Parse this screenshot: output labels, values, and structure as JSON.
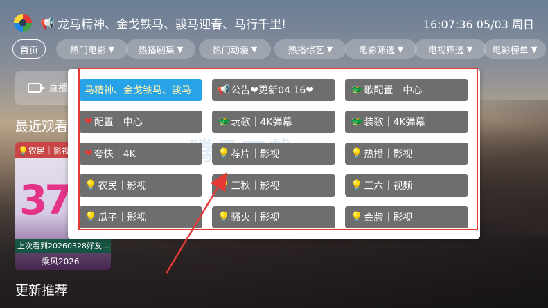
{
  "header": {
    "announcement": "龙马精神、金戈铁马、骏马迎春、马行千里!",
    "clock": "16:07:36 05/03 周日"
  },
  "nav": {
    "items": [
      {
        "label": "首页",
        "filter": false,
        "active": true
      },
      {
        "label": "热门电影",
        "filter": true
      },
      {
        "label": "热播剧集",
        "filter": true
      },
      {
        "label": "热门动漫",
        "filter": true
      },
      {
        "label": "热播综艺",
        "filter": true
      },
      {
        "label": "电影筛选",
        "filter": true
      },
      {
        "label": "电视筛选",
        "filter": true
      },
      {
        "label": "电影榜单",
        "filter": true
      }
    ]
  },
  "left": {
    "live_label": "直播",
    "recent_title": "最近观看",
    "recent_card": {
      "tag": "💡农民｜影视",
      "art": "37",
      "art2": "乘",
      "art3": "2026",
      "progress": "上次看到20260328好友...",
      "name": "乘风2026"
    },
    "update_title": "更新推荐"
  },
  "popup": {
    "watermark": "腾品下载",
    "sources": [
      {
        "icon": "",
        "icon_name": "none",
        "label": "马精神、金戈铁马、骏马",
        "selected": true
      },
      {
        "icon": "📢",
        "icon_name": "horn-icon",
        "label": "公告❤更新04.16❤"
      },
      {
        "icon": "🐲",
        "icon_name": "dragon-icon",
        "label": "歌配置｜中心"
      },
      {
        "icon": "❤",
        "icon_name": "heart-icon",
        "label": "配置｜中心"
      },
      {
        "icon": "🐲",
        "icon_name": "dragon-icon",
        "label": "玩歌｜4K弹幕"
      },
      {
        "icon": "🐲",
        "icon_name": "dragon-icon",
        "label": "装歌｜4K弹幕"
      },
      {
        "icon": "❤",
        "icon_name": "heart-icon",
        "label": "夸快｜4K"
      },
      {
        "icon": "💡",
        "icon_name": "bulb-icon",
        "label": "荐片｜影视"
      },
      {
        "icon": "💡",
        "icon_name": "bulb-icon",
        "label": "热播｜影视"
      },
      {
        "icon": "💡",
        "icon_name": "bulb-icon",
        "label": "农民｜影视"
      },
      {
        "icon": "💡",
        "icon_name": "bulb-icon",
        "label": "三秋｜影视"
      },
      {
        "icon": "💡",
        "icon_name": "bulb-icon",
        "label": "三六｜视频"
      },
      {
        "icon": "💡",
        "icon_name": "bulb-icon",
        "label": "瓜子｜影视"
      },
      {
        "icon": "💡",
        "icon_name": "bulb-icon",
        "label": "骚火｜影视"
      },
      {
        "icon": "💡",
        "icon_name": "bulb-icon",
        "label": "金牌｜影视"
      }
    ]
  },
  "colors": {
    "popup_bg": "#ffffff",
    "button_bg": "#6e6e6e",
    "selected_bg": "#29a3e8",
    "highlight_border": "#e53935"
  }
}
